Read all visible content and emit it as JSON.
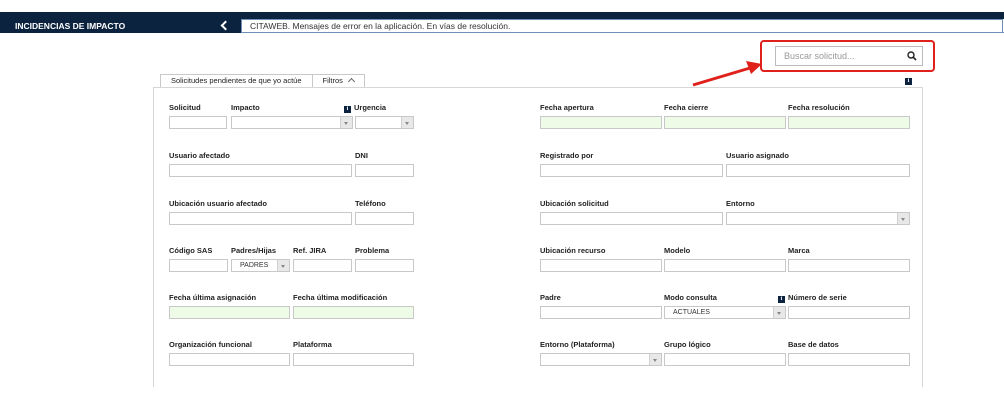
{
  "header": {
    "section_title": "INCIDENCIAS DE IMPACTO",
    "collapse_icon": "chevron-left-icon",
    "subtitle": "CITAWEB. Mensajes de error en la aplicación. En vías de resolución."
  },
  "search": {
    "placeholder": "Buscar solicitud...",
    "value": "",
    "icon": "search-icon",
    "highlight_color": "#e0201b"
  },
  "tabs": [
    {
      "label": "Solicitudes pendientes de que yo actúe"
    },
    {
      "label": "Filtros",
      "icon": "caret-up-icon"
    }
  ],
  "colors": {
    "primary": "#0c2340",
    "field_date_bg": "#eefbe6",
    "border": "#c8c8c8"
  },
  "filters": {
    "solicitud": "Solicitud",
    "impacto": "Impacto",
    "urgencia": "Urgencia",
    "fecha_apertura": "Fecha apertura",
    "fecha_cierre": "Fecha cierre",
    "fecha_resolucion": "Fecha resolución",
    "usuario_afectado": "Usuario afectado",
    "dni": "DNI",
    "registrado_por": "Registrado por",
    "usuario_asignado": "Usuario asignado",
    "ubicacion_usuario_afectado": "Ubicación usuario afectado",
    "telefono": "Teléfono",
    "ubicacion_solicitud": "Ubicación solicitud",
    "entorno": "Entorno",
    "codigo_sas": "Código SAS",
    "padres_hijas": "Padres/Hijas",
    "padres_hijas_value": "PADRES",
    "ref_jira": "Ref. JIRA",
    "problema": "Problema",
    "ubicacion_recurso": "Ubicación recurso",
    "modelo": "Modelo",
    "marca": "Marca",
    "fecha_ultima_asignacion": "Fecha última asignación",
    "fecha_ultima_modificacion": "Fecha última modificación",
    "padre": "Padre",
    "modo_consulta": "Modo consulta",
    "modo_consulta_value": "ACTUALES",
    "numero_serie": "Número de serie",
    "organizacion_funcional": "Organización funcional",
    "plataforma": "Plataforma",
    "entorno_plataforma": "Entorno (Plataforma)",
    "grupo_logico": "Grupo lógico",
    "base_de_datos": "Base de datos"
  }
}
